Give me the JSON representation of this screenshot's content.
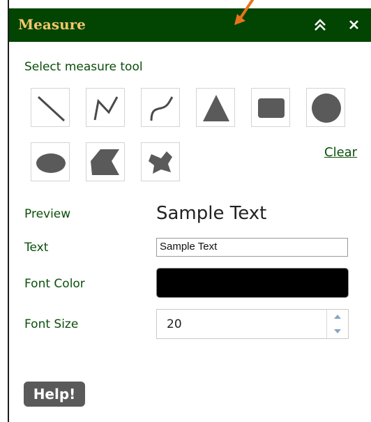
{
  "panel": {
    "title": "Measure"
  },
  "tools": {
    "label": "Select measure tool",
    "items": [
      {
        "icon": "line-icon"
      },
      {
        "icon": "polyline-icon"
      },
      {
        "icon": "freehand-line-icon"
      },
      {
        "icon": "triangle-icon"
      },
      {
        "icon": "rectangle-icon"
      },
      {
        "icon": "circle-icon"
      },
      {
        "icon": "ellipse-icon"
      },
      {
        "icon": "polygon-icon"
      },
      {
        "icon": "freehand-polygon-icon"
      }
    ],
    "clear_label": "Clear"
  },
  "text_settings": {
    "preview_label": "Preview",
    "preview_text": "Sample Text",
    "text_label": "Text",
    "text_value": "Sample Text",
    "font_color_label": "Font Color",
    "font_color": "#000000",
    "font_size_label": "Font Size",
    "font_size": "20"
  },
  "help_label": "Help!",
  "colors": {
    "titlebar": "#024402",
    "title_text": "#f2c66b",
    "label_text": "#0a4f0a",
    "icon_fill": "#5a5a5a",
    "annotation_arrow": "#e8731a"
  }
}
